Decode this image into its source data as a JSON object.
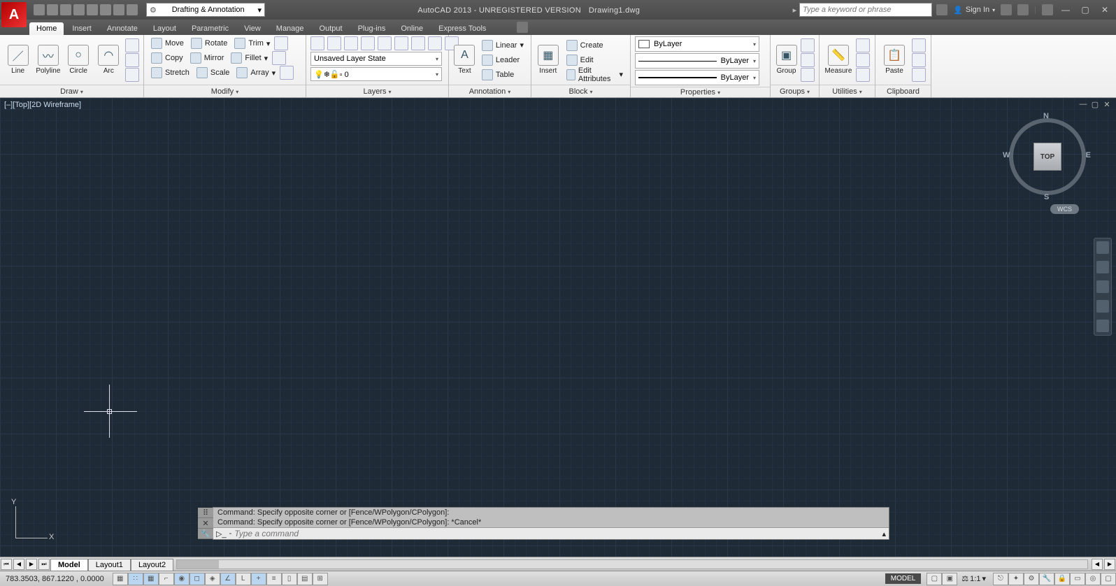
{
  "title": {
    "app": "AutoCAD 2013 - UNREGISTERED VERSION",
    "file": "Drawing1.dwg"
  },
  "workspace": "Drafting & Annotation",
  "search_placeholder": "Type a keyword or phrase",
  "signin": "Sign In",
  "tabs": [
    "Home",
    "Insert",
    "Annotate",
    "Layout",
    "Parametric",
    "View",
    "Manage",
    "Output",
    "Plug-ins",
    "Online",
    "Express Tools"
  ],
  "ribbon": {
    "draw": {
      "title": "Draw",
      "btns": [
        "Line",
        "Polyline",
        "Circle",
        "Arc"
      ]
    },
    "modify": {
      "title": "Modify",
      "rows": [
        [
          "Move",
          "Rotate",
          "Trim"
        ],
        [
          "Copy",
          "Mirror",
          "Fillet"
        ],
        [
          "Stretch",
          "Scale",
          "Array"
        ]
      ]
    },
    "layers": {
      "title": "Layers",
      "state": "Unsaved Layer State",
      "current": "0"
    },
    "annotation": {
      "title": "Annotation",
      "big": "Text",
      "rows": [
        "Linear",
        "Leader",
        "Table"
      ]
    },
    "block": {
      "title": "Block",
      "big": "Insert",
      "rows": [
        "Create",
        "Edit",
        "Edit Attributes"
      ]
    },
    "properties": {
      "title": "Properties",
      "color": "ByLayer",
      "ltype": "ByLayer",
      "lweight": "ByLayer"
    },
    "groups": {
      "title": "Groups",
      "big": "Group"
    },
    "utilities": {
      "title": "Utilities",
      "big": "Measure"
    },
    "clipboard": {
      "title": "Clipboard",
      "big": "Paste"
    }
  },
  "viewport": {
    "label": "[–][Top][2D Wireframe]",
    "cube": "TOP",
    "dirs": {
      "n": "N",
      "s": "S",
      "e": "E",
      "w": "W"
    },
    "wcs": "WCS"
  },
  "ucs": {
    "x": "X",
    "y": "Y"
  },
  "cmd": {
    "h1": "Command: Specify opposite corner or [Fence/WPolygon/CPolygon]:",
    "h2": "Command: Specify opposite corner or [Fence/WPolygon/CPolygon]: *Cancel*",
    "placeholder": "Type a command"
  },
  "model_tabs": [
    "Model",
    "Layout1",
    "Layout2"
  ],
  "status": {
    "coords": "783.3503, 867.1220 , 0.0000",
    "model": "MODEL",
    "scale": "1:1"
  }
}
